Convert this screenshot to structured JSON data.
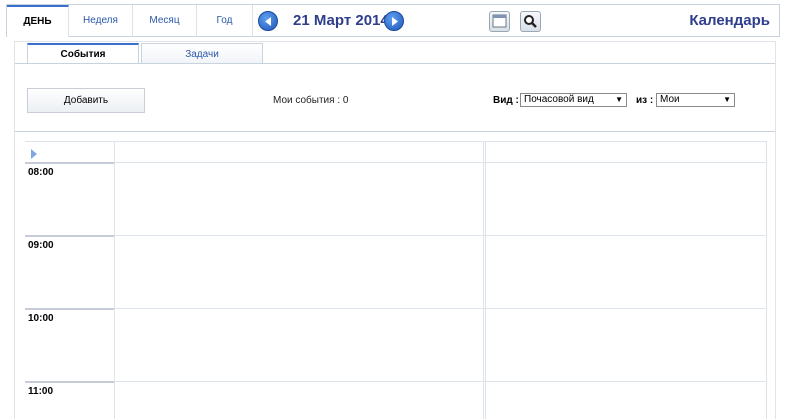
{
  "view_tabs": [
    {
      "label": "ДЕНЬ",
      "active": true
    },
    {
      "label": "Неделя",
      "active": false
    },
    {
      "label": "Месяц",
      "active": false
    },
    {
      "label": "Год",
      "active": false
    }
  ],
  "date_label": "21 Март 2014",
  "app_title": "Календарь",
  "sub_tabs": [
    {
      "label": "События",
      "active": true
    },
    {
      "label": "Задачи",
      "active": false
    }
  ],
  "add_button": "Добавить",
  "my_events": "Мои события : 0",
  "view_label": "Вид :",
  "view_select": "Почасовой вид",
  "of_label": "из :",
  "of_select": "Мои",
  "hours": [
    "08:00",
    "09:00",
    "10:00",
    "11:00"
  ],
  "icons": {
    "prev": "prev-arrow-icon",
    "next": "next-arrow-icon",
    "calendar": "calendar-icon",
    "search": "search-icon",
    "expand": "expand-arrow-icon"
  },
  "colors": {
    "accent": "#2f3e8c",
    "link": "#2a58a8",
    "nav_button": "#1e56b8"
  }
}
